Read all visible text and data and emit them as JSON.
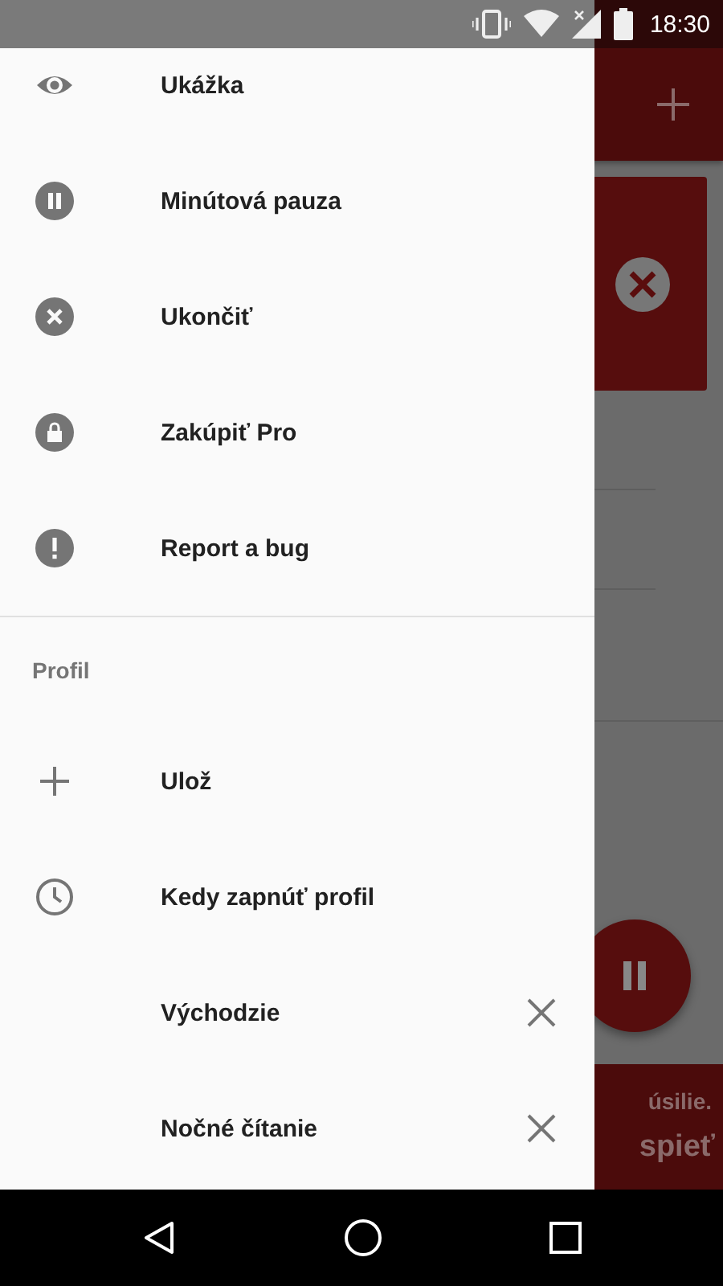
{
  "status_bar": {
    "time": "18:30"
  },
  "drawer": {
    "items": [
      {
        "label": "Ukážka"
      },
      {
        "label": "Minútová pauza"
      },
      {
        "label": "Ukončiť"
      },
      {
        "label": "Zakúpiť Pro"
      },
      {
        "label": "Report a bug"
      }
    ],
    "section": {
      "title": "Profil",
      "actions": [
        {
          "label": "Ulož"
        },
        {
          "label": "Kedy zapnúť profil"
        }
      ],
      "profiles": [
        {
          "label": "Východzie"
        },
        {
          "label": "Nočné čítanie"
        }
      ]
    }
  },
  "background": {
    "banner_lines": [
      "úsilie.",
      "spieť"
    ]
  }
}
